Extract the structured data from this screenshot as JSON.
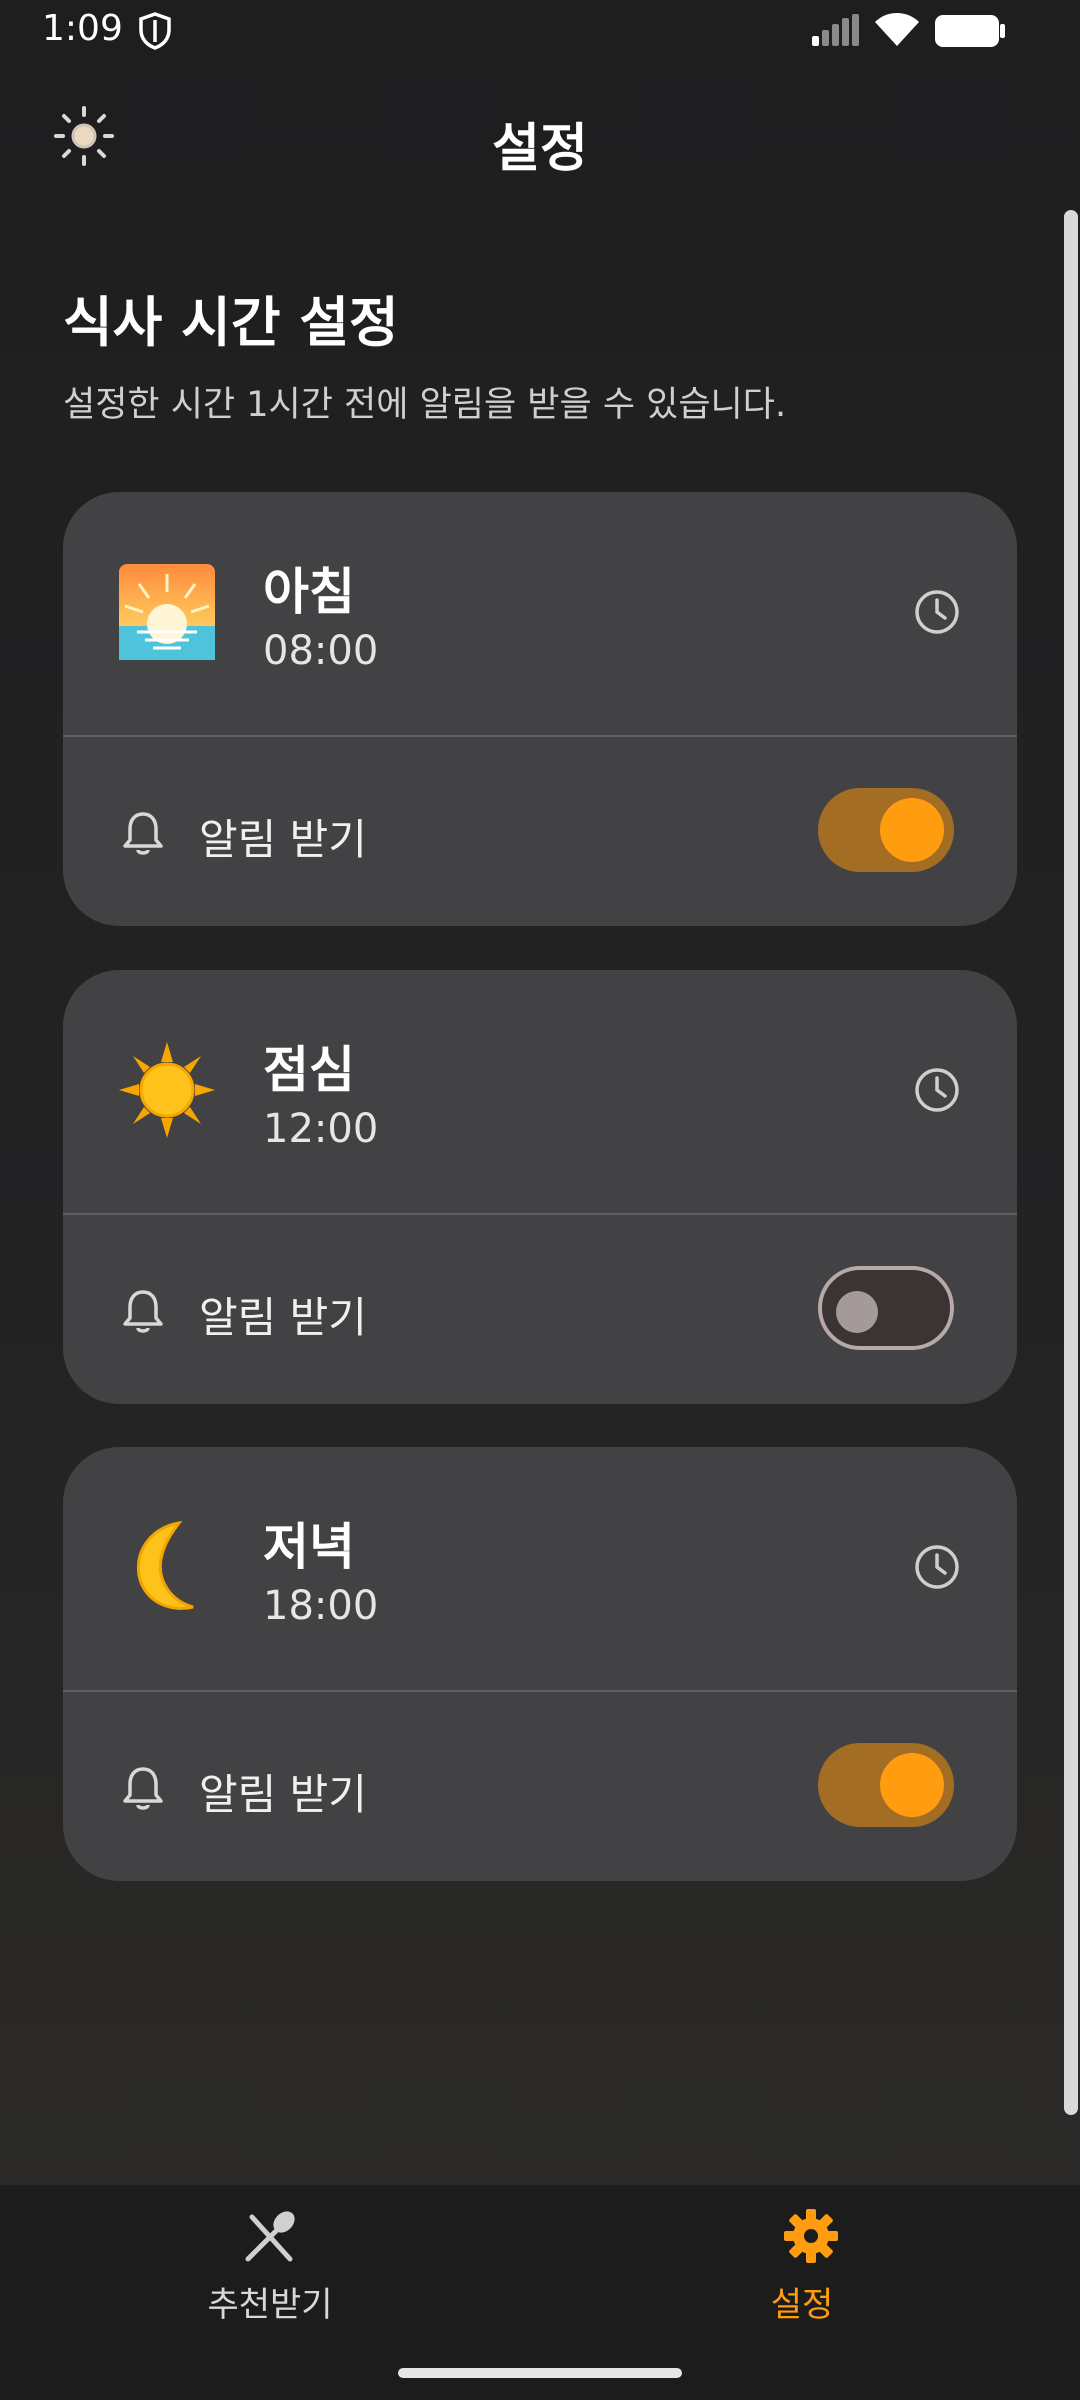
{
  "status_bar": {
    "time": "1:09"
  },
  "header": {
    "title": "설정",
    "theme_icon": "sun-outline-icon"
  },
  "section": {
    "title": "식사 시간 설정",
    "description": "설정한 시간 1시간 전에 알림을 받을 수 있습니다."
  },
  "meals": [
    {
      "name": "아침",
      "time": "08:00",
      "icon": "sunrise-emoji",
      "notify_label": "알림 받기",
      "notify_on": true
    },
    {
      "name": "점심",
      "time": "12:00",
      "icon": "sun-emoji",
      "notify_label": "알림 받기",
      "notify_on": false
    },
    {
      "name": "저녁",
      "time": "18:00",
      "icon": "crescent-moon-emoji",
      "notify_label": "알림 받기",
      "notify_on": true
    }
  ],
  "bottom_nav": {
    "items": [
      {
        "label": "추천받기",
        "icon": "utensils-icon",
        "active": false
      },
      {
        "label": "설정",
        "icon": "gear-icon",
        "active": true
      }
    ]
  },
  "colors": {
    "accent": "#ff9c10",
    "card_bg": "#424244",
    "toggle_track_on": "#a36d23"
  }
}
